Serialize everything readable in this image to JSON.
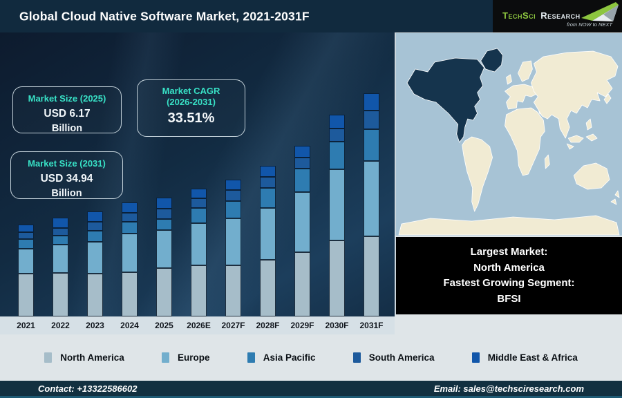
{
  "header": {
    "title": "Global Cloud Native Software Market, 2021-2031F",
    "logo": {
      "brand_primary": "TechSci",
      "brand_secondary": "Research",
      "tagline": "from NOW to NEXT"
    }
  },
  "colors": {
    "accent_teal": "#38e1c6",
    "brand_green": "#8dc63f"
  },
  "info_boxes": [
    {
      "title": "Market Size (2025)",
      "value": "USD 6.17",
      "unit": "Billion"
    },
    {
      "title": "Market CAGR",
      "subtitle": "(2026-2031)",
      "value": "33.51%"
    },
    {
      "title": "Market Size (2031)",
      "value": "USD 34.94",
      "unit": "Billion"
    }
  ],
  "chart_data": {
    "type": "bar",
    "stacked": true,
    "title": "Global Cloud Native Software Market, 2021-2031F",
    "note": "No value axis shown; segment values are relative height units read from the image (1 unit = 1 px)",
    "categories": [
      "2021",
      "2022",
      "2023",
      "2024",
      "2025",
      "2026E",
      "2027F",
      "2028F",
      "2029F",
      "2030F",
      "2031F"
    ],
    "series": [
      {
        "name": "North America",
        "color": "#a6bdc9",
        "values": [
          62,
          63,
          62,
          64,
          70,
          74,
          74,
          82,
          93,
          110,
          116
        ]
      },
      {
        "name": "Europe",
        "color": "#72aecd",
        "values": [
          36,
          41,
          46,
          56,
          55,
          61,
          68,
          75,
          87,
          103,
          109
        ]
      },
      {
        "name": "Asia Pacific",
        "color": "#2e7cb1",
        "values": [
          14,
          13,
          16,
          17,
          16,
          22,
          25,
          29,
          34,
          40,
          46
        ]
      },
      {
        "name": "South America",
        "color": "#1d5a9c",
        "values": [
          10,
          11,
          13,
          13,
          15,
          14,
          16,
          16,
          16,
          19,
          27
        ]
      },
      {
        "name": "Middle East & Africa",
        "color": "#1156aa",
        "values": [
          11,
          15,
          15,
          15,
          16,
          14,
          15,
          16,
          17,
          20,
          25
        ]
      }
    ],
    "totals": [
      133,
      143,
      152,
      165,
      172,
      185,
      198,
      218,
      247,
      292,
      323
    ],
    "ylim": [
      0,
      340
    ],
    "grid": false,
    "legend_position": "bottom"
  },
  "map": {
    "highlight_region": "North America",
    "ocean_color": "#a7c3d5",
    "land_color": "#f1ebd3",
    "highlight_color": "#15344d"
  },
  "callout": {
    "lines": [
      "Largest Market:",
      "North America",
      "Fastest Growing Segment:",
      "BFSI"
    ]
  },
  "footer": {
    "contact": "Contact: +13322586602",
    "email": "Email: sales@techsciresearch.com"
  }
}
